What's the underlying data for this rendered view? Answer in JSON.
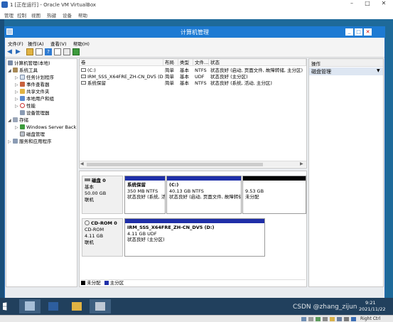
{
  "vbox": {
    "title": "1 [正在运行] - Oracle VM VirtualBox",
    "menu": [
      "管理",
      "控制",
      "视图",
      "热键",
      "设备",
      "帮助"
    ]
  },
  "window": {
    "title": "计算机管理",
    "menu": [
      "文件(F)",
      "操作(A)",
      "查看(V)",
      "帮助(H)"
    ]
  },
  "tree": {
    "root": "计算机管理(本地)",
    "system_tools": "系统工具",
    "task_scheduler": "任务计划程序",
    "event_viewer": "事件查看器",
    "shared_folders": "共享文件夹",
    "local_users": "本地用户和组",
    "performance": "性能",
    "device_manager": "设备管理器",
    "storage": "存储",
    "windows_server_backup": "Windows Server Back",
    "disk_management": "磁盘管理",
    "services_apps": "服务和应用程序"
  },
  "volumes": {
    "headers": [
      "卷",
      "布局",
      "类型",
      "文件...",
      "状态"
    ],
    "rows": [
      [
        "(C:)",
        "简单",
        "基本",
        "NTFS",
        "状态良好 (启动, 页面文件, 故障转储, 主分区)"
      ],
      [
        "IRM_SSS_X64FRE_ZH-CN_DV5 (D:)",
        "简单",
        "基本",
        "UDF",
        "状态良好 (主分区)"
      ],
      [
        "系统保留",
        "简单",
        "基本",
        "NTFS",
        "状态良好 (系统, 活动, 主分区)"
      ]
    ]
  },
  "disks": {
    "disk0": {
      "name": "磁盘 0",
      "type": "基本",
      "size": "50.00 GB",
      "status": "联机",
      "partitions": [
        {
          "name": "系统保留",
          "size": "350 MB NTFS",
          "status": "状态良好 (系统, 活"
        },
        {
          "name": "(C:)",
          "size": "40.13 GB NTFS",
          "status": "状态良好 (启动, 页面文件, 故障转储"
        },
        {
          "name": "",
          "size": "9.53 GB",
          "status": "未分配"
        }
      ]
    },
    "cdrom0": {
      "name": "CD-ROM 0",
      "type": "CD-ROM",
      "size": "4.11 GB",
      "status": "联机",
      "partition": {
        "name": "IRM_SSS_X64FRE_ZH-CN_DV5 (D:)",
        "size": "4.11 GB UDF",
        "status": "状态良好 (主分区)"
      }
    },
    "legend": {
      "unallocated": "未分配",
      "primary": "主分区"
    }
  },
  "actions": {
    "header": "操作",
    "item": "磁盘管理"
  },
  "taskbar": {
    "time": "9:21",
    "date": "2021/11/22",
    "watermark": "CSDN @zhang_zijun",
    "host_key": "Right Ctrl"
  },
  "colors": {
    "title_blue": "#1d7ad3",
    "partition_blue": "#1f2fa8",
    "unallocated_black": "#000000",
    "taskbar": "#21405d"
  }
}
